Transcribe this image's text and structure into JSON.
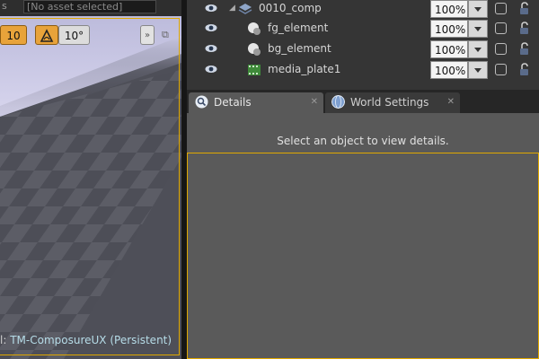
{
  "viewport": {
    "topbar_crumb": "s",
    "asset_field": "[No asset selected]",
    "grid_snap_value": "10",
    "rotation_snap_value": "10°",
    "maximize_glyph": "»",
    "restore_glyph": "⧉",
    "world_prefix": "l:",
    "world_level": "TM-ComposureUX (Persistent)"
  },
  "outliner": {
    "rows": [
      {
        "label": "0010_comp",
        "opacity": "100%",
        "icon": "composite-layers-icon"
      },
      {
        "label": "fg_element",
        "opacity": "100%",
        "icon": "element-sphere-icon"
      },
      {
        "label": "bg_element",
        "opacity": "100%",
        "icon": "element-sphere-icon"
      },
      {
        "label": "media_plate1",
        "opacity": "100%",
        "icon": "media-plate-icon"
      }
    ]
  },
  "details": {
    "tabs": [
      {
        "label": "Details",
        "close": "✕"
      },
      {
        "label": "World Settings",
        "close": "✕"
      }
    ],
    "empty_message": "Select an object to view details."
  },
  "colors": {
    "accent": "#e0a800",
    "panel_bg": "#595959",
    "outliner_bg": "#353535"
  }
}
